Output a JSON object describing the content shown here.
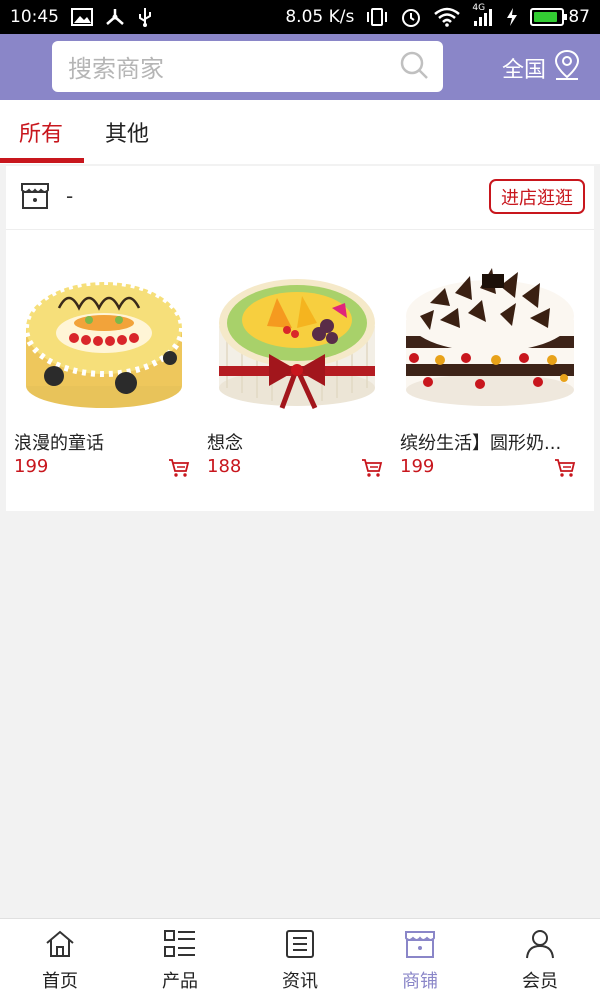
{
  "status_bar": {
    "time": "10:45",
    "speed": "8.05 K/s",
    "network": "4G",
    "battery": "87",
    "battery_level": 0.87
  },
  "header": {
    "search_placeholder": "搜索商家",
    "region_label": "全国"
  },
  "tabs": [
    {
      "label": "所有",
      "active": true
    },
    {
      "label": "其他",
      "active": false
    }
  ],
  "store": {
    "name": "-",
    "visit_label": "进店逛逛",
    "products": [
      {
        "name": "浪漫的童话",
        "price": "199"
      },
      {
        "name": "想念",
        "price": "188"
      },
      {
        "name": "缤纷生活】圆形奶...",
        "price": "199"
      }
    ]
  },
  "bottom_nav": [
    {
      "label": "首页",
      "icon": "home-icon",
      "active": false
    },
    {
      "label": "产品",
      "icon": "grid-list-icon",
      "active": false
    },
    {
      "label": "资讯",
      "icon": "news-icon",
      "active": false
    },
    {
      "label": "商铺",
      "icon": "store-icon",
      "active": true
    },
    {
      "label": "会员",
      "icon": "user-icon",
      "active": false
    }
  ],
  "colors": {
    "header_bg": "#8a86c8",
    "accent_red": "#c8161d",
    "active_nav": "#8a86c8"
  }
}
